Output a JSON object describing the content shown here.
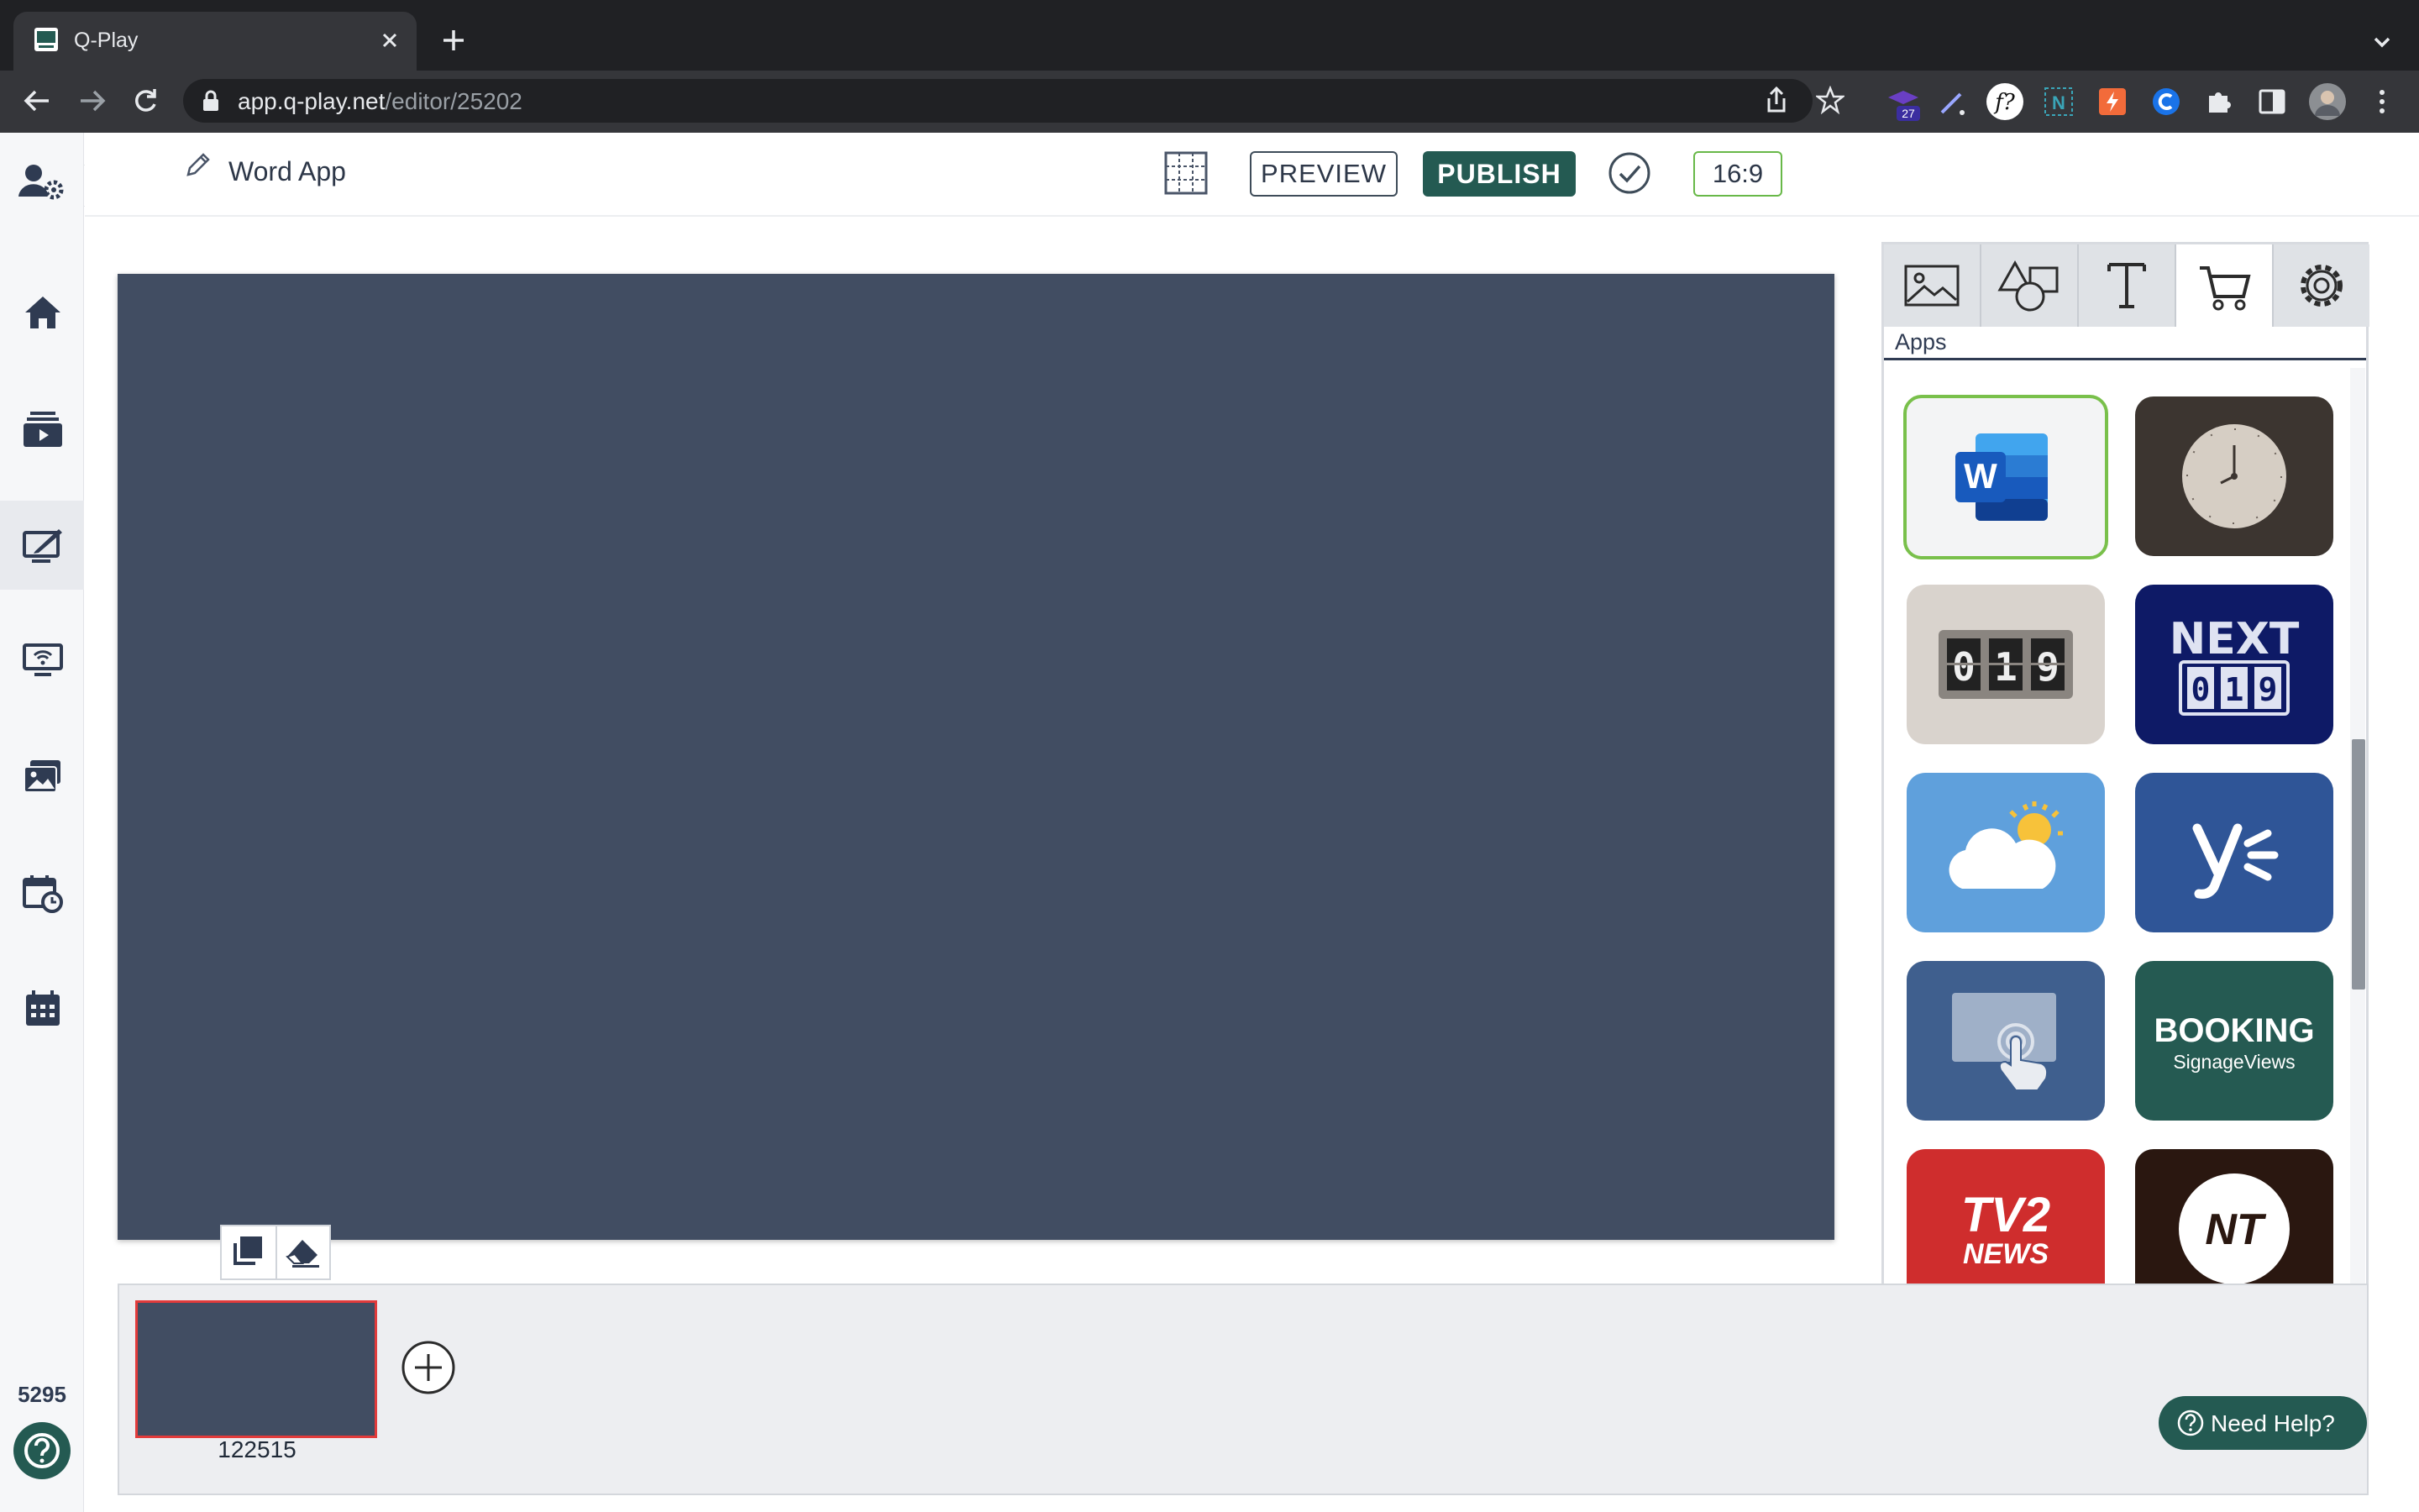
{
  "browser": {
    "tab_title": "Q-Play",
    "url_host": "app.q-play.net",
    "url_path": "/editor/25202",
    "extension_badge": "27"
  },
  "sidebar": {
    "items": [
      {
        "name": "account-settings",
        "icon": "user-gear-icon"
      },
      {
        "name": "home",
        "icon": "home-icon"
      },
      {
        "name": "playlists",
        "icon": "media-stack-icon"
      },
      {
        "name": "editor",
        "icon": "edit-screen-icon",
        "active": true
      },
      {
        "name": "screens",
        "icon": "wifi-monitor-icon"
      },
      {
        "name": "media",
        "icon": "images-icon"
      },
      {
        "name": "schedules",
        "icon": "calendar-clock-icon"
      },
      {
        "name": "calendar",
        "icon": "calendar-icon"
      }
    ],
    "expand_label": ">",
    "count": "5295"
  },
  "header": {
    "project_name": "Word App",
    "preview_label": "PREVIEW",
    "publish_label": "PUBLISH",
    "aspect_ratio": "16:9"
  },
  "panel": {
    "tabs": [
      "image-icon",
      "shapes-icon",
      "text-icon",
      "cart-icon",
      "gear-icon"
    ],
    "active_tab": 3,
    "section_label": "Apps",
    "apps": [
      {
        "name": "word",
        "bg": "#f3f4f5"
      },
      {
        "name": "clock",
        "bg": "#3c3530"
      },
      {
        "name": "counter",
        "bg": "#d9d3cd"
      },
      {
        "name": "next-counter",
        "bg": "#0e1a66",
        "text": "NEXT"
      },
      {
        "name": "weather",
        "bg": "#5fa0dc"
      },
      {
        "name": "yammer",
        "bg": "#2f5597"
      },
      {
        "name": "touch",
        "bg": "#3f5f8e"
      },
      {
        "name": "booking",
        "bg": "#255a52",
        "text": "BOOKING",
        "subtext": "SignageViews"
      },
      {
        "name": "tv2-news",
        "bg": "#cf2d2d",
        "text": "TV2",
        "subtext": "NEWS"
      },
      {
        "name": "nt",
        "bg": "#2a1710",
        "text": "NT"
      }
    ]
  },
  "slides": {
    "items": [
      {
        "id": "122515"
      }
    ]
  },
  "help": {
    "label": "Need Help?"
  },
  "colors": {
    "accent": "#245a52",
    "canvas": "#414d62",
    "selected_border": "#79c04b",
    "slide_selected": "#e23b3b"
  }
}
